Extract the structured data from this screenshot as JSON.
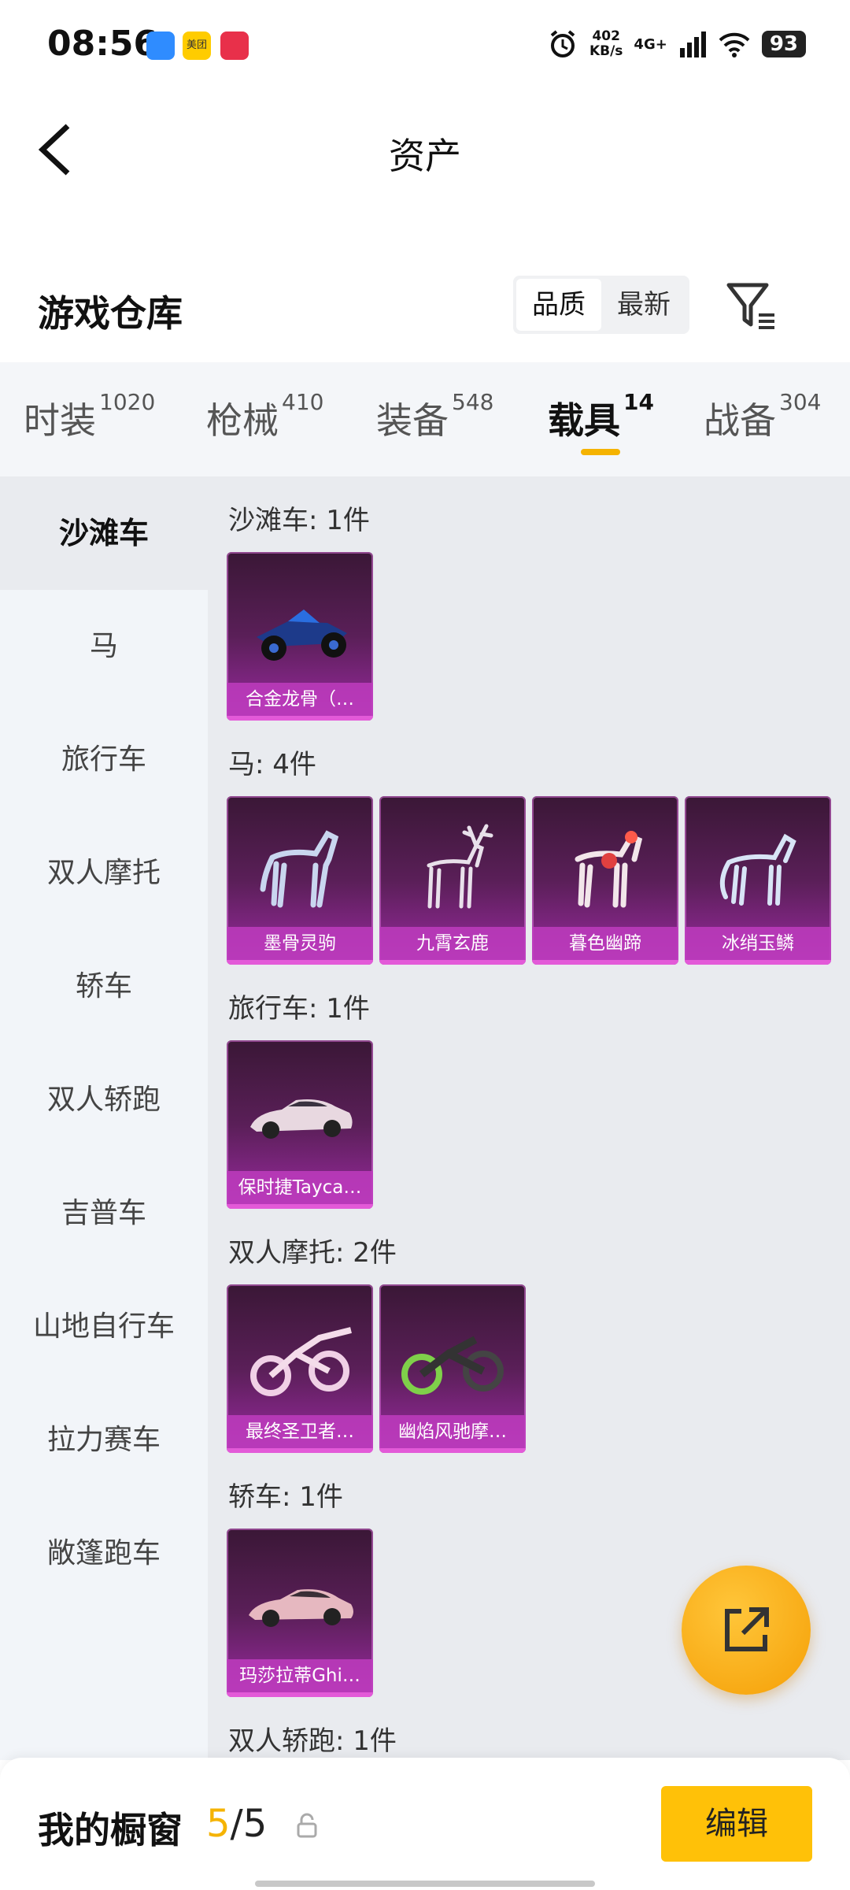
{
  "status_bar": {
    "time": "08:56",
    "speed_value": "402",
    "speed_unit": "KB/s",
    "network": "4G+",
    "battery": "93",
    "app_icons": [
      {
        "name": "app-icon-blue",
        "color": "#2f8cff"
      },
      {
        "name": "meituan-icon",
        "color": "#ffcc00",
        "text": "美团"
      },
      {
        "name": "app-icon-red",
        "color": "#e8304a"
      }
    ]
  },
  "nav": {
    "title": "资产"
  },
  "warehouse": {
    "title": "游戏仓库",
    "sort_options": [
      "品质",
      "最新"
    ],
    "active_sort": "品质"
  },
  "tabs": [
    {
      "label": "时装",
      "count": "1020"
    },
    {
      "label": "枪械",
      "count": "410"
    },
    {
      "label": "装备",
      "count": "548"
    },
    {
      "label": "载具",
      "count": "14",
      "active": true
    },
    {
      "label": "战备",
      "count": "304"
    }
  ],
  "sidebar": {
    "items": [
      "沙滩车",
      "马",
      "旅行车",
      "双人摩托",
      "轿车",
      "双人轿跑",
      "吉普车",
      "山地自行车",
      "拉力赛车",
      "敞篷跑车"
    ],
    "active": "沙滩车"
  },
  "sections": [
    {
      "title": "沙滩车: 1件",
      "items": [
        {
          "label": "合金龙骨（…",
          "icon": "buggy-icon"
        }
      ]
    },
    {
      "title": "马: 4件",
      "items": [
        {
          "label": "墨骨灵驹",
          "icon": "horse-icon"
        },
        {
          "label": "九霄玄鹿",
          "icon": "deer-icon"
        },
        {
          "label": "暮色幽蹄",
          "icon": "horse-icon"
        },
        {
          "label": "冰绡玉鳞",
          "icon": "qilin-icon"
        }
      ]
    },
    {
      "title": "旅行车: 1件",
      "items": [
        {
          "label": "保时捷Tayca…",
          "icon": "car-icon"
        }
      ]
    },
    {
      "title": "双人摩托: 2件",
      "items": [
        {
          "label": "最终圣卫者…",
          "icon": "motorcycle-icon"
        },
        {
          "label": "幽焰风驰摩…",
          "icon": "motorcycle-icon"
        }
      ]
    },
    {
      "title": "轿车: 1件",
      "items": [
        {
          "label": "玛莎拉蒂Ghi…",
          "icon": "car-icon"
        }
      ]
    },
    {
      "title": "双人轿跑: 1件",
      "items": []
    }
  ],
  "bottom_bar": {
    "label": "我的橱窗",
    "current": "5",
    "separator": "/",
    "total": "5",
    "edit_label": "编辑"
  },
  "colors": {
    "accent": "#f5b301",
    "card_gradient_top": "#3a1736",
    "card_gradient_bottom": "#9a2aa0"
  }
}
